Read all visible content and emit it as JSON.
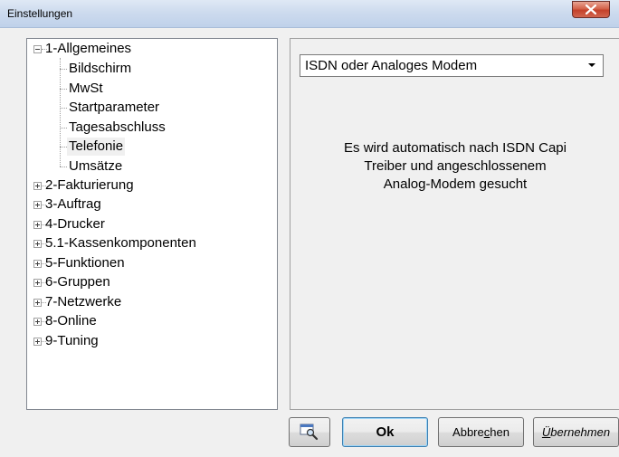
{
  "window": {
    "title": "Einstellungen",
    "close_label": "x"
  },
  "tree": {
    "root": "1-Allgemeines",
    "children": [
      "Bildschirm",
      "MwSt",
      "Startparameter",
      "Tagesabschluss",
      "Telefonie",
      "Umsätze"
    ],
    "selected": "Telefonie",
    "collapsed": [
      "2-Fakturierung",
      "3-Auftrag",
      "4-Drucker",
      "5.1-Kassenkomponenten",
      "5-Funktionen",
      "6-Gruppen",
      "7-Netzwerke",
      "8-Online",
      "9-Tuning"
    ]
  },
  "panel": {
    "dropdown_value": "ISDN oder Analoges Modem",
    "info_lines": [
      "Es wird automatisch nach ISDN Capi",
      "Treiber und angeschlossenem",
      "Analog-Modem gesucht"
    ]
  },
  "buttons": {
    "icon_button": "search-window-icon",
    "ok": "Ok",
    "cancel_pre": "Abbre",
    "cancel_accel": "c",
    "cancel_post": "hen",
    "apply_accel": "Ü",
    "apply_post": "bernehmen"
  }
}
